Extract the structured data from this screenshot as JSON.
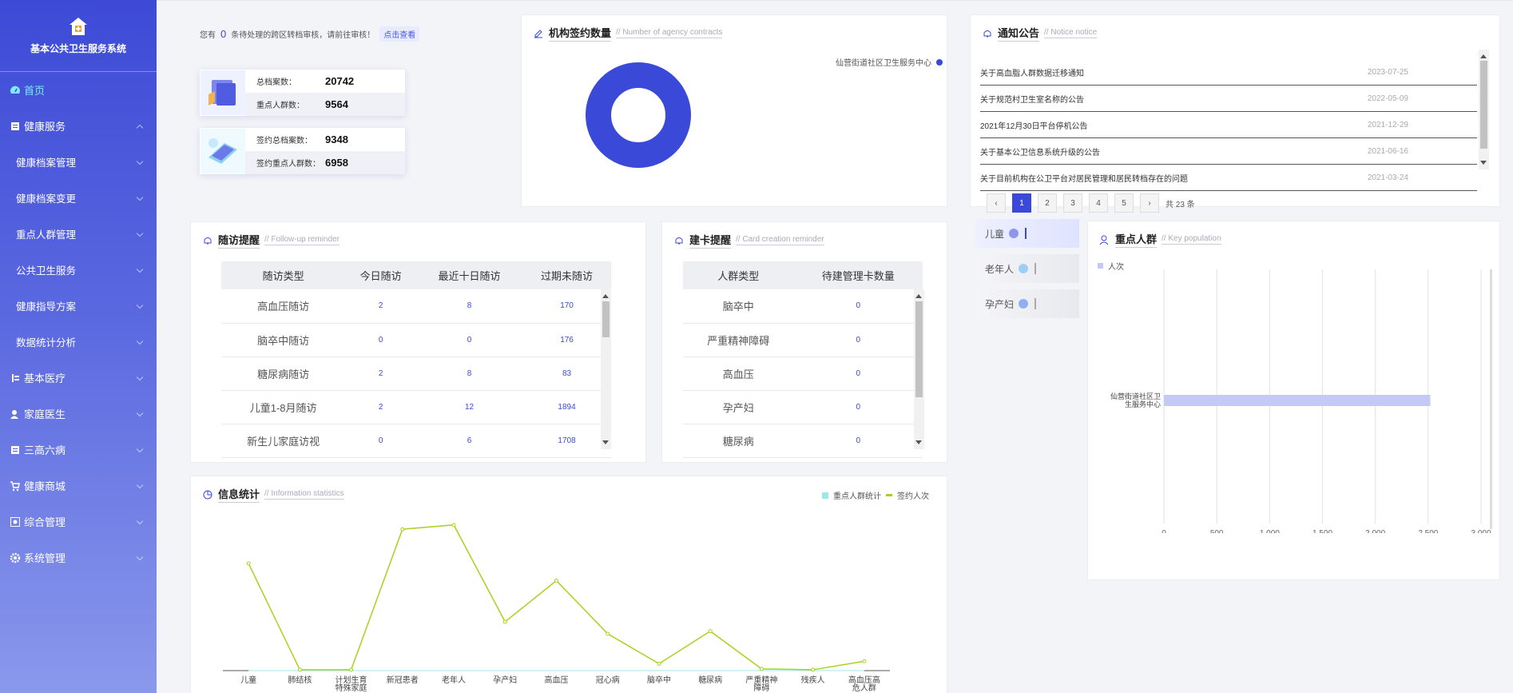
{
  "sidebar": {
    "title": "基本公共卫生服务系统",
    "items": [
      {
        "label": "首页",
        "icon": "dashboard-icon"
      },
      {
        "label": "健康服务",
        "icon": "document-icon"
      },
      {
        "label": "健康档案管理"
      },
      {
        "label": "健康档案变更"
      },
      {
        "label": "重点人群管理"
      },
      {
        "label": "公共卫生服务"
      },
      {
        "label": "健康指导方案"
      },
      {
        "label": "数据统计分析"
      },
      {
        "label": "基本医疗",
        "icon": "medical-icon"
      },
      {
        "label": "家庭医生",
        "icon": "user-icon"
      },
      {
        "label": "三高六病",
        "icon": "document-icon"
      },
      {
        "label": "健康商城",
        "icon": "cart-icon"
      },
      {
        "label": "综合管理",
        "icon": "settings-box-icon"
      },
      {
        "label": "系统管理",
        "icon": "gear-icon"
      }
    ]
  },
  "pending": {
    "prefix": "您有",
    "count": "0",
    "suffix": "条待处理的跨区转档审核，请前往审核！",
    "button": "点击查看"
  },
  "stats": [
    {
      "rows": [
        {
          "label": "总档案数：",
          "value": "20742"
        },
        {
          "label": "重点人群数：",
          "value": "9564"
        }
      ]
    },
    {
      "rows": [
        {
          "label": "签约总档案数：",
          "value": "9348"
        },
        {
          "label": "签约重点人群数：",
          "value": "6958"
        }
      ]
    }
  ],
  "contracts": {
    "title": "机构签约数量",
    "subtitle": "// Number of agency contracts",
    "legend": "仙营街道社区卫生服务中心",
    "color": "#3a49d8"
  },
  "notice": {
    "title": "通知公告",
    "subtitle": "// Notice notice",
    "items": [
      {
        "text": "关于高血脂人群数据迁移通知",
        "date": "2023-07-25"
      },
      {
        "text": "关于规范村卫生室名称的公告",
        "date": "2022-05-09"
      },
      {
        "text": "2021年12月30日平台停机公告",
        "date": "2021-12-29"
      },
      {
        "text": "关于基本公卫信息系统升级的公告",
        "date": "2021-06-16"
      },
      {
        "text": "关于目前机构在公卫平台对居民管理和居民转档存在的问题",
        "date": "2021-03-24"
      }
    ],
    "pages": [
      "1",
      "2",
      "3",
      "4",
      "5"
    ],
    "total": "共 23 条"
  },
  "followup": {
    "title": "随访提醒",
    "subtitle": "// Follow-up reminder",
    "headers": [
      "随访类型",
      "今日随访",
      "最近十日随访",
      "过期未随访"
    ],
    "rows": [
      [
        "高血压随访",
        "2",
        "8",
        "170"
      ],
      [
        "脑卒中随访",
        "0",
        "0",
        "176"
      ],
      [
        "糖尿病随访",
        "2",
        "8",
        "83"
      ],
      [
        "儿童1-8月随访",
        "2",
        "12",
        "1894"
      ],
      [
        "新生儿家庭访视",
        "0",
        "6",
        "1708"
      ]
    ]
  },
  "card": {
    "title": "建卡提醒",
    "subtitle": "// Card creation reminder",
    "headers": [
      "人群类型",
      "待建管理卡数量"
    ],
    "rows": [
      [
        "脑卒中",
        "0"
      ],
      [
        "严重精神障碍",
        "0"
      ],
      [
        "高血压",
        "0"
      ],
      [
        "孕产妇",
        "0"
      ],
      [
        "糖尿病",
        "0"
      ]
    ]
  },
  "groups": {
    "tabs": [
      "儿童",
      "老年人",
      "孕产妇"
    ]
  },
  "keypop": {
    "title": "重点人群",
    "subtitle": "// Key population",
    "legend": "人次",
    "chart_data": {
      "type": "bar",
      "orientation": "horizontal",
      "categories": [
        "仙营街道社区卫生服务中心"
      ],
      "series": [
        {
          "name": "人次",
          "values": [
            2520
          ]
        }
      ],
      "xlim": [
        0,
        3000
      ],
      "ticks": [
        "0",
        "500",
        "1,000",
        "1,500",
        "2,000",
        "2,500",
        "3,000"
      ],
      "color": "#c5c9f5"
    }
  },
  "info": {
    "title": "信息统计",
    "subtitle": "// Information statistics",
    "chart_data": {
      "type": "line",
      "categories": [
        "儿童",
        "肺结核",
        "计划生育特殊家庭",
        "新冠患者",
        "老年人",
        "孕产妇",
        "高血压",
        "冠心病",
        "脑卒中",
        "糖尿病",
        "严重精神障碍",
        "残疾人",
        "高血压高危人群"
      ],
      "series": [
        {
          "name": "重点人群统计",
          "values": [
            0,
            0,
            0,
            0,
            0,
            0,
            0,
            0,
            0,
            0,
            0,
            0,
            0
          ],
          "color": "#9ee8e8"
        },
        {
          "name": "签约人次",
          "values": [
            1250,
            10,
            10,
            1650,
            1700,
            570,
            1050,
            430,
            80,
            460,
            20,
            10,
            110
          ],
          "color": "#a8d21e"
        }
      ],
      "ylim": [
        0,
        1800
      ]
    }
  }
}
